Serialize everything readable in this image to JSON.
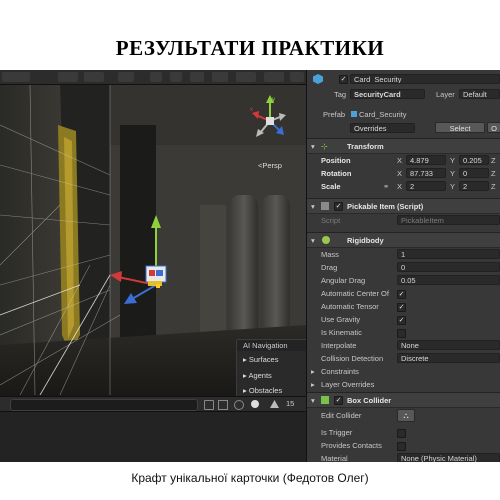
{
  "slide_title": "РЕЗУЛЬТАТИ ПРАКТИКИ",
  "caption": "Крафт унікальної карточки (Федотов Олег)",
  "scene": {
    "persp_label": "<Persp",
    "ai_nav": {
      "title": "AI Navigation",
      "items": [
        "Surfaces",
        "Agents",
        "Obstacles"
      ]
    },
    "console_count": "15"
  },
  "inspector": {
    "object_name": "Card_Security",
    "tag_label": "Tag",
    "tag_value": "SecurityCard",
    "layer_label": "Layer",
    "layer_value": "Default",
    "prefab_label": "Prefab",
    "prefab_value": "Card_Security",
    "overrides": "Overrides",
    "select": "Select",
    "open": "O",
    "transform": {
      "title": "Transform",
      "position_label": "Position",
      "rotation_label": "Rotation",
      "scale_label": "Scale",
      "position": {
        "x": "4.879",
        "y": "0.205",
        "z": "Z"
      },
      "rotation": {
        "x": "87.733",
        "y": "0",
        "z": "Z"
      },
      "scale": {
        "x": "2",
        "y": "2",
        "z": "Z"
      }
    },
    "pickable": {
      "title": "Pickable Item (Script)",
      "script_label": "Script",
      "script_value": "PickableItem"
    },
    "rigidbody": {
      "title": "Rigidbody",
      "mass_label": "Mass",
      "mass": "1",
      "drag_label": "Drag",
      "drag": "0",
      "angular_drag_label": "Angular Drag",
      "angular_drag": "0.05",
      "auto_center_label": "Automatic Center Of",
      "auto_tensor_label": "Automatic Tensor",
      "use_gravity_label": "Use Gravity",
      "is_kinematic_label": "Is Kinematic",
      "interpolate_label": "Interpolate",
      "interpolate": "None",
      "collision_label": "Collision Detection",
      "collision": "Discrete",
      "constraints_label": "Constraints",
      "layer_overrides_label": "Layer Overrides"
    },
    "box_collider": {
      "title": "Box Collider",
      "edit_label": "Edit Collider",
      "trigger_label": "Is Trigger",
      "contacts_label": "Provides Contacts",
      "material_label": "Material",
      "material_value": "None (Physic Material)"
    }
  },
  "colors": {
    "x_axis": "#d23a3a",
    "y_axis": "#8fd13a",
    "z_axis": "#3a6ed2",
    "selected_axis_blue": "#2d64e0"
  }
}
